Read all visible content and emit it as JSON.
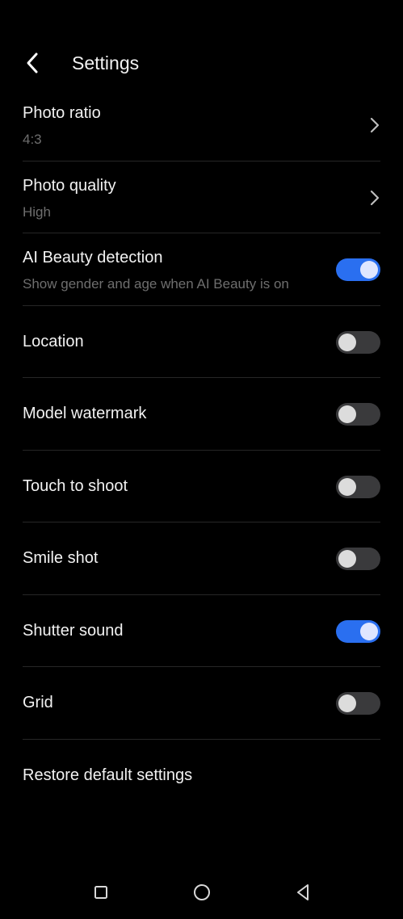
{
  "header": {
    "title": "Settings",
    "back_icon": "chevron-left-icon"
  },
  "settings": {
    "photo_ratio": {
      "label": "Photo ratio",
      "value": "4:3"
    },
    "photo_quality": {
      "label": "Photo quality",
      "value": "High"
    },
    "ai_beauty": {
      "label": "AI Beauty detection",
      "description": "Show gender and age when AI Beauty is on",
      "enabled": true
    },
    "location": {
      "label": "Location",
      "enabled": false
    },
    "model_watermark": {
      "label": "Model watermark",
      "enabled": false
    },
    "touch_to_shoot": {
      "label": "Touch to shoot",
      "enabled": false
    },
    "smile_shot": {
      "label": "Smile shot",
      "enabled": false
    },
    "shutter_sound": {
      "label": "Shutter sound",
      "enabled": true
    },
    "grid": {
      "label": "Grid",
      "enabled": false
    },
    "restore": {
      "label": "Restore default settings"
    }
  },
  "navigation": {
    "icons": [
      "square-recents-icon",
      "circle-home-icon",
      "triangle-back-icon"
    ]
  },
  "colors": {
    "background": "#000000",
    "accent": "#2a6ff0",
    "toggle_off": "#3a3a3c",
    "secondary_text": "#6e6e6e"
  }
}
